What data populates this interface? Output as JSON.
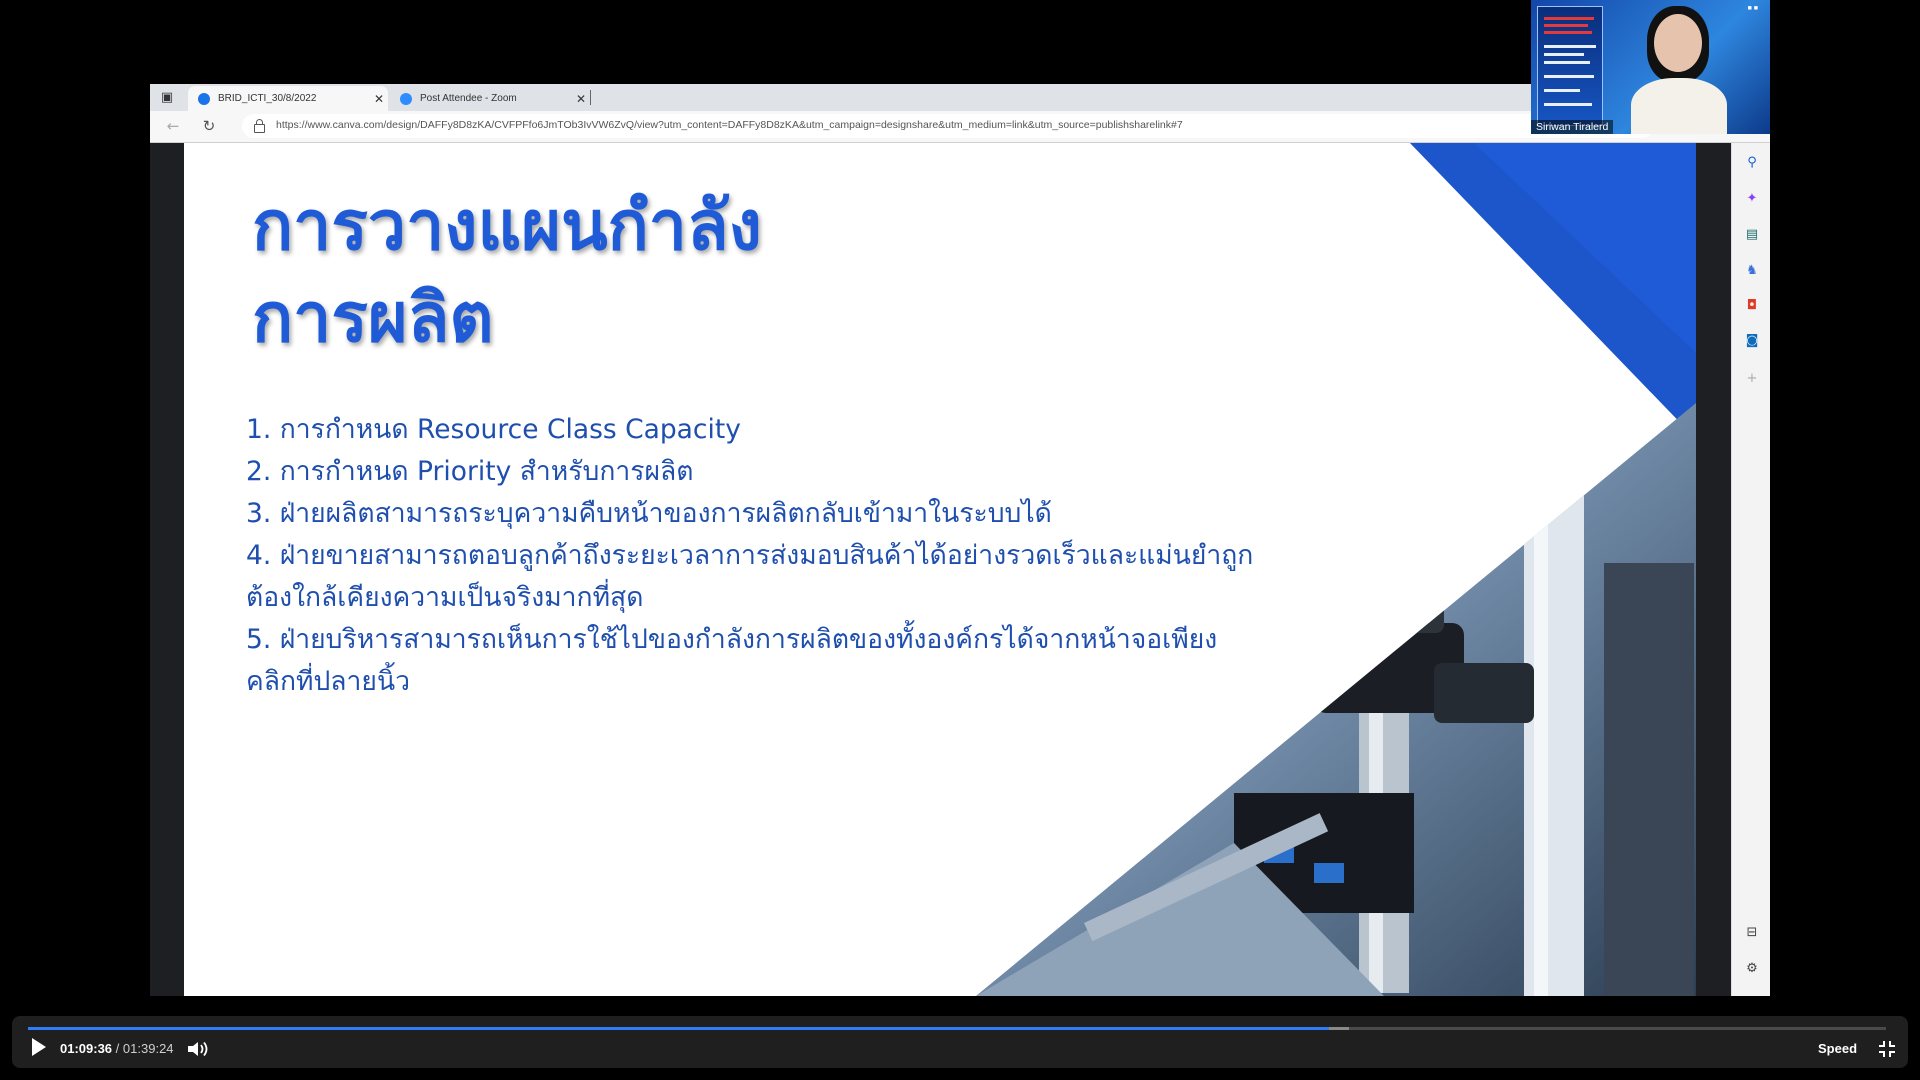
{
  "browser": {
    "tabs": [
      {
        "title": "BRID_ICTI_30/8/2022",
        "active": true,
        "favicon_color": "#1a73e8"
      },
      {
        "title": "Post Attendee - Zoom",
        "active": false,
        "favicon_color": "#2d8cff"
      }
    ],
    "tab_close_glyph": "✕",
    "url": "https://www.canva.com/design/DAFFy8D8zKA/CVFPFfo6JmTOb3IvVW6ZvQ/view?utm_content=DAFFy8D8zKA&utm_campaign=designshare&utm_medium=link&utm_source=publishsharelink#7"
  },
  "slide": {
    "title_line1": "การวางแผนกำลัง",
    "title_line2": "การผลิต",
    "items": [
      "1. การกำหนด Resource Class Capacity",
      "2. การกำหนด Priority สำหรับการผลิต",
      "3. ฝ่ายผลิตสามารถระบุความคืบหน้าของการผลิตกลับเข้ามาในระบบได้",
      "4. ฝ่ายขายสามารถตอบลูกค้าถึงระยะเวลาการส่งมอบสินค้าได้อย่างรวดเร็วและแม่นยำถูกต้องใกล้เคียงความเป็นจริงมากที่สุด",
      "5. ฝ่ายบริหารสามารถเห็นการใช้ไปของกำลังการผลิตของทั้งองค์กรได้จากหน้าจอเพียงคลิกที่ปลายนิ้ว"
    ],
    "accent_color": "#1f5bd6"
  },
  "sidebar_icons": [
    "search-icon",
    "copilot-icon",
    "briefcase-icon",
    "games-icon",
    "office-icon",
    "outlook-icon",
    "add-icon",
    "sidebar-toggle-icon",
    "settings-icon"
  ],
  "webcam": {
    "name": "Siriwan Tiralerd"
  },
  "player": {
    "current_time": "01:09:36",
    "separator": "/",
    "duration": "01:39:24",
    "speed_label": "Speed",
    "progress": 0.7003,
    "buffered": 0.7109,
    "accent": "#2f7cf6"
  }
}
